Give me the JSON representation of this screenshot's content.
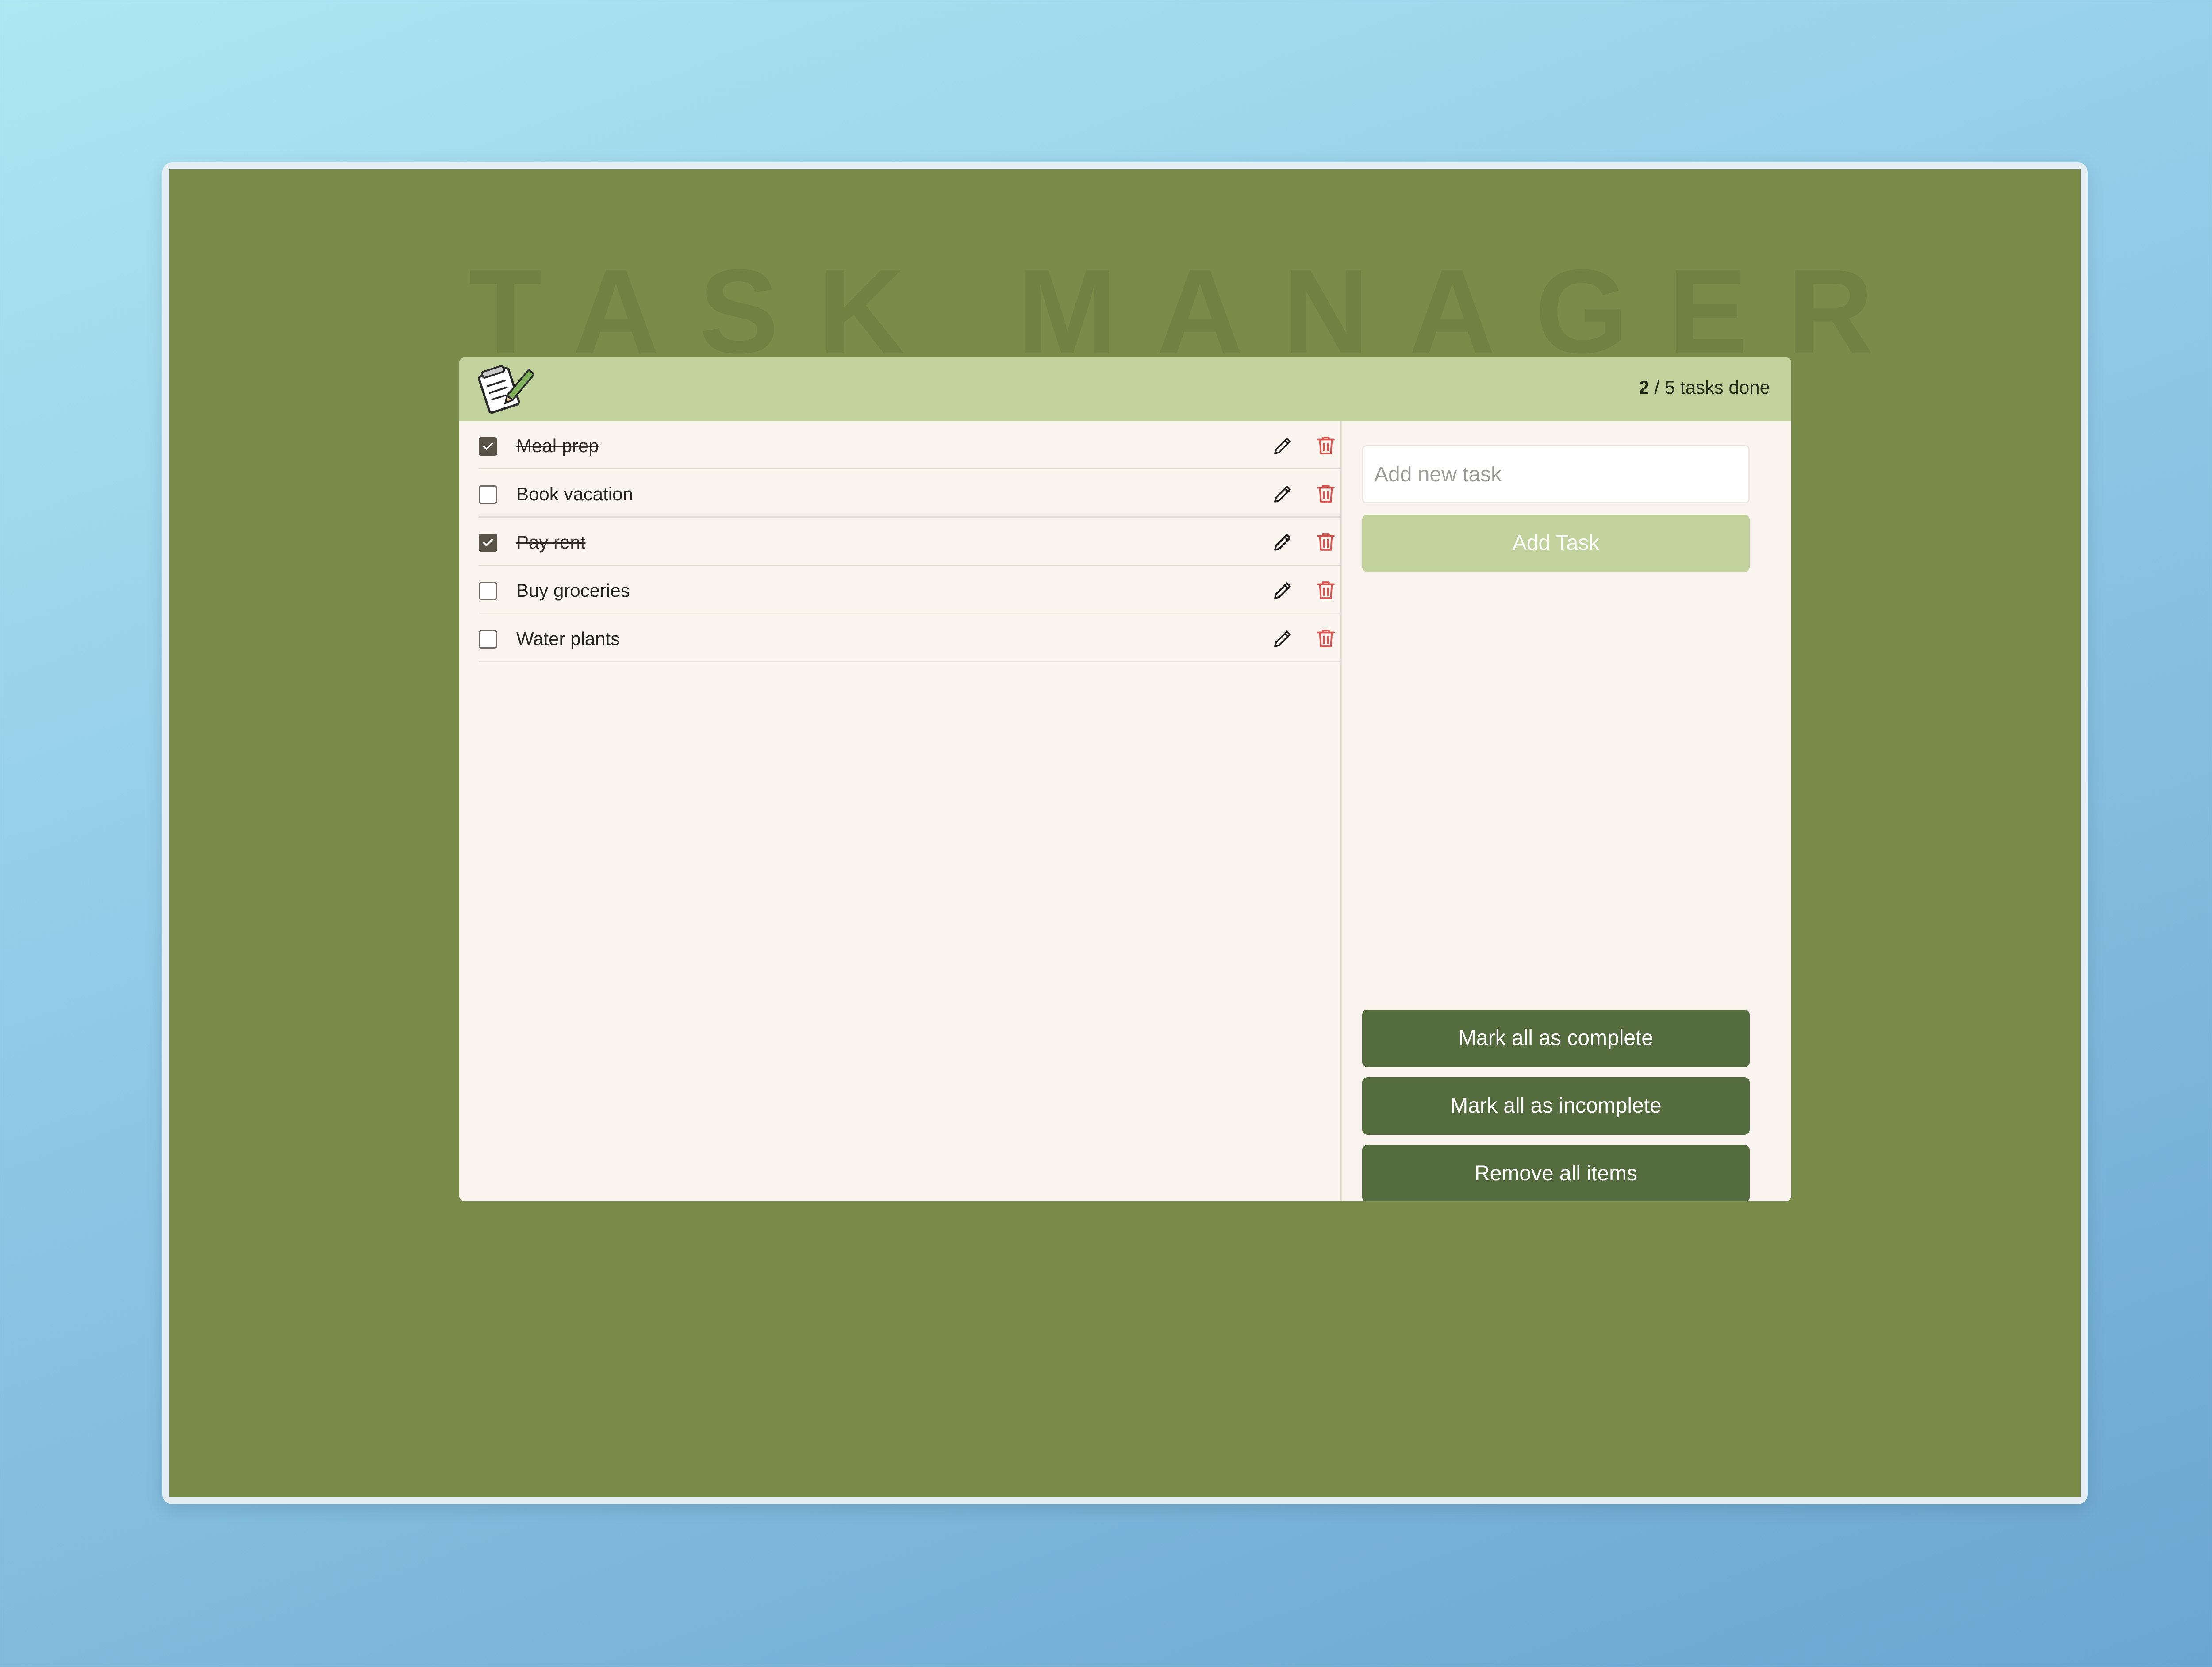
{
  "app": {
    "watermark": "TASK MANAGER"
  },
  "header": {
    "logo_icon": "notepad-pencil-icon",
    "progress": {
      "done": "2",
      "rest": " / 5 tasks done"
    }
  },
  "tasks": [
    {
      "label": "Meal prep",
      "completed": true
    },
    {
      "label": "Book vacation",
      "completed": false
    },
    {
      "label": "Pay rent",
      "completed": true
    },
    {
      "label": "Buy groceries",
      "completed": false
    },
    {
      "label": "Water plants",
      "completed": false
    }
  ],
  "task_actions": {
    "edit_icon": "pencil-icon",
    "delete_icon": "trash-icon"
  },
  "sidebar": {
    "input_placeholder": "Add new task",
    "input_value": "",
    "add_button": "Add Task",
    "mark_complete_button": "Mark all as complete",
    "mark_incomplete_button": "Mark all as incomplete",
    "remove_all_button": "Remove all items"
  },
  "colors": {
    "backdrop": "#7a8c49",
    "header": "#c2d29c",
    "card": "#f9f4ee",
    "dark_button": "#546b3e",
    "delete_icon": "#d9534f"
  }
}
